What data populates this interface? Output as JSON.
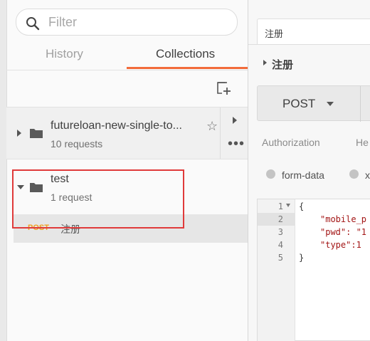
{
  "sidebar": {
    "search": {
      "placeholder": "Filter"
    },
    "tabs": {
      "history": "History",
      "collections": "Collections"
    },
    "collections": [
      {
        "name": "futureloan-new-single-to...",
        "count": "10 requests",
        "expanded": false
      },
      {
        "name": "test",
        "count": "1 request",
        "expanded": true,
        "requests": [
          {
            "method": "POST",
            "name": "注册"
          }
        ]
      }
    ]
  },
  "main": {
    "tab_label": "注册",
    "request_title": "注册",
    "method": "POST",
    "subtabs": {
      "authorization": "Authorization",
      "headers": "He"
    },
    "body_types": {
      "form_data": "form-data",
      "other": "x"
    },
    "editor": {
      "line_numbers": [
        "1",
        "2",
        "3",
        "4",
        "5"
      ],
      "lines": [
        "{",
        "\"mobile_p",
        "\"pwd\": \"1",
        "\"type\":1",
        "}"
      ]
    }
  },
  "colors": {
    "accent": "#f26b3a",
    "highlight_border": "#e03a3a",
    "post_method": "#f0a020"
  }
}
